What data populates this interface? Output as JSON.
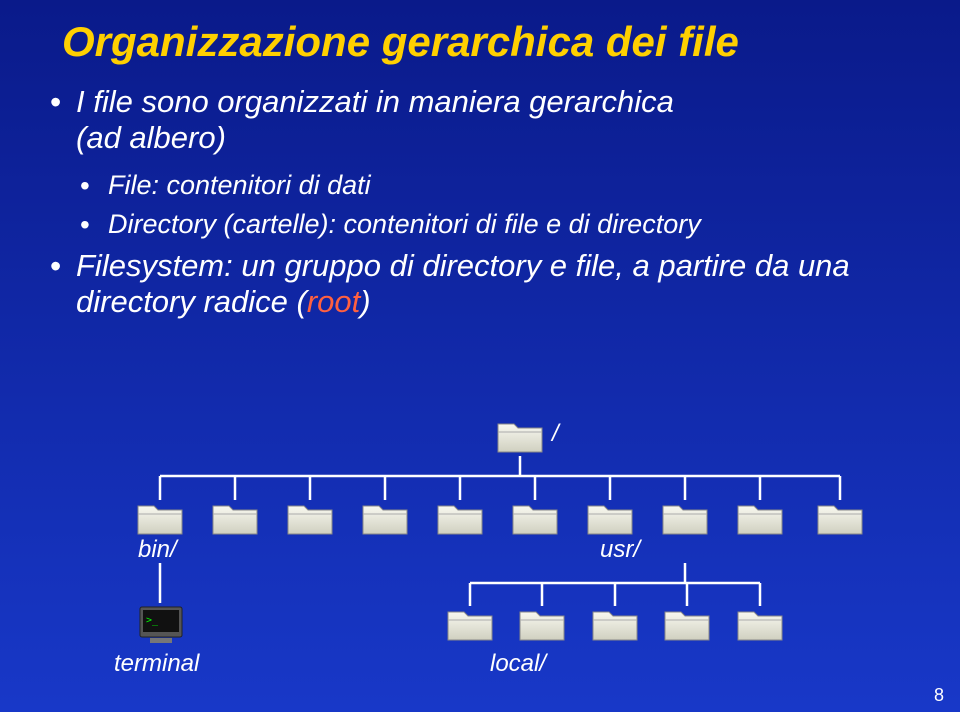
{
  "title": "Organizzazione gerarchica dei file",
  "bullets": {
    "b1_line1": "I file sono organizzati in maniera gerarchica",
    "b1_line2": "(ad albero)",
    "b2": "File: contenitori di dati",
    "b3": "Directory (cartelle): contenitori di file e di directory",
    "b4_pre": "Filesystem: un gruppo di directory e file, a partire da una directory radice (",
    "b4_accent": "root",
    "b4_post": ")"
  },
  "tree": {
    "root_label": "/",
    "level1": {
      "bin_label": "bin/",
      "usr_label": "usr/"
    },
    "level2": {
      "terminal_label": "terminal",
      "local_label": "local/"
    }
  },
  "slide_number": "8"
}
